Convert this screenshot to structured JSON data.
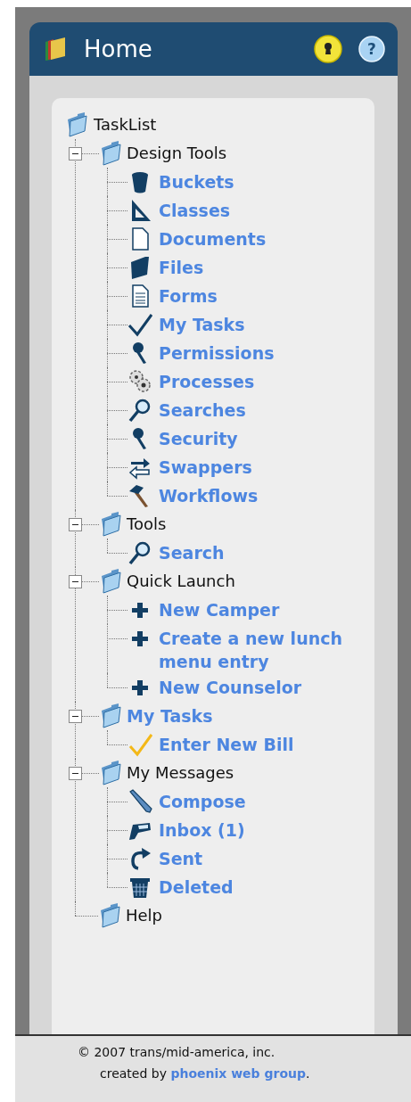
{
  "header": {
    "title": "Home",
    "help_button": "?"
  },
  "tree": {
    "label": "TaskList",
    "link": false,
    "children": [
      {
        "label": "Design Tools",
        "link": false,
        "expanded": true,
        "children": [
          {
            "label": "Buckets",
            "link": true
          },
          {
            "label": "Classes",
            "link": true
          },
          {
            "label": "Documents",
            "link": true
          },
          {
            "label": "Files",
            "link": true
          },
          {
            "label": "Forms",
            "link": true
          },
          {
            "label": "My Tasks",
            "link": true
          },
          {
            "label": "Permissions",
            "link": true
          },
          {
            "label": "Processes",
            "link": true
          },
          {
            "label": "Searches",
            "link": true
          },
          {
            "label": "Security",
            "link": true
          },
          {
            "label": "Swappers",
            "link": true
          },
          {
            "label": "Workflows",
            "link": true
          }
        ]
      },
      {
        "label": "Tools",
        "link": false,
        "expanded": true,
        "children": [
          {
            "label": "Search",
            "link": true
          }
        ]
      },
      {
        "label": "Quick Launch",
        "link": false,
        "expanded": true,
        "children": [
          {
            "label": "New Camper",
            "link": true
          },
          {
            "label": "Create a new lunch menu entry",
            "link": true
          },
          {
            "label": "New Counselor",
            "link": true
          }
        ]
      },
      {
        "label": "My Tasks",
        "link": true,
        "expanded": true,
        "children": [
          {
            "label": "Enter New Bill",
            "link": true
          }
        ]
      },
      {
        "label": "My Messages",
        "link": false,
        "expanded": true,
        "children": [
          {
            "label": "Compose",
            "link": true
          },
          {
            "label": "Inbox (1)",
            "link": true
          },
          {
            "label": "Sent",
            "link": true
          },
          {
            "label": "Deleted",
            "link": true
          }
        ]
      },
      {
        "label": "Help",
        "link": false
      }
    ]
  },
  "footer": {
    "copyright": "© 2007 trans/mid-america, inc.",
    "credit_text": "created by",
    "credit_link": "phoenix web group",
    "credit_end": "."
  }
}
